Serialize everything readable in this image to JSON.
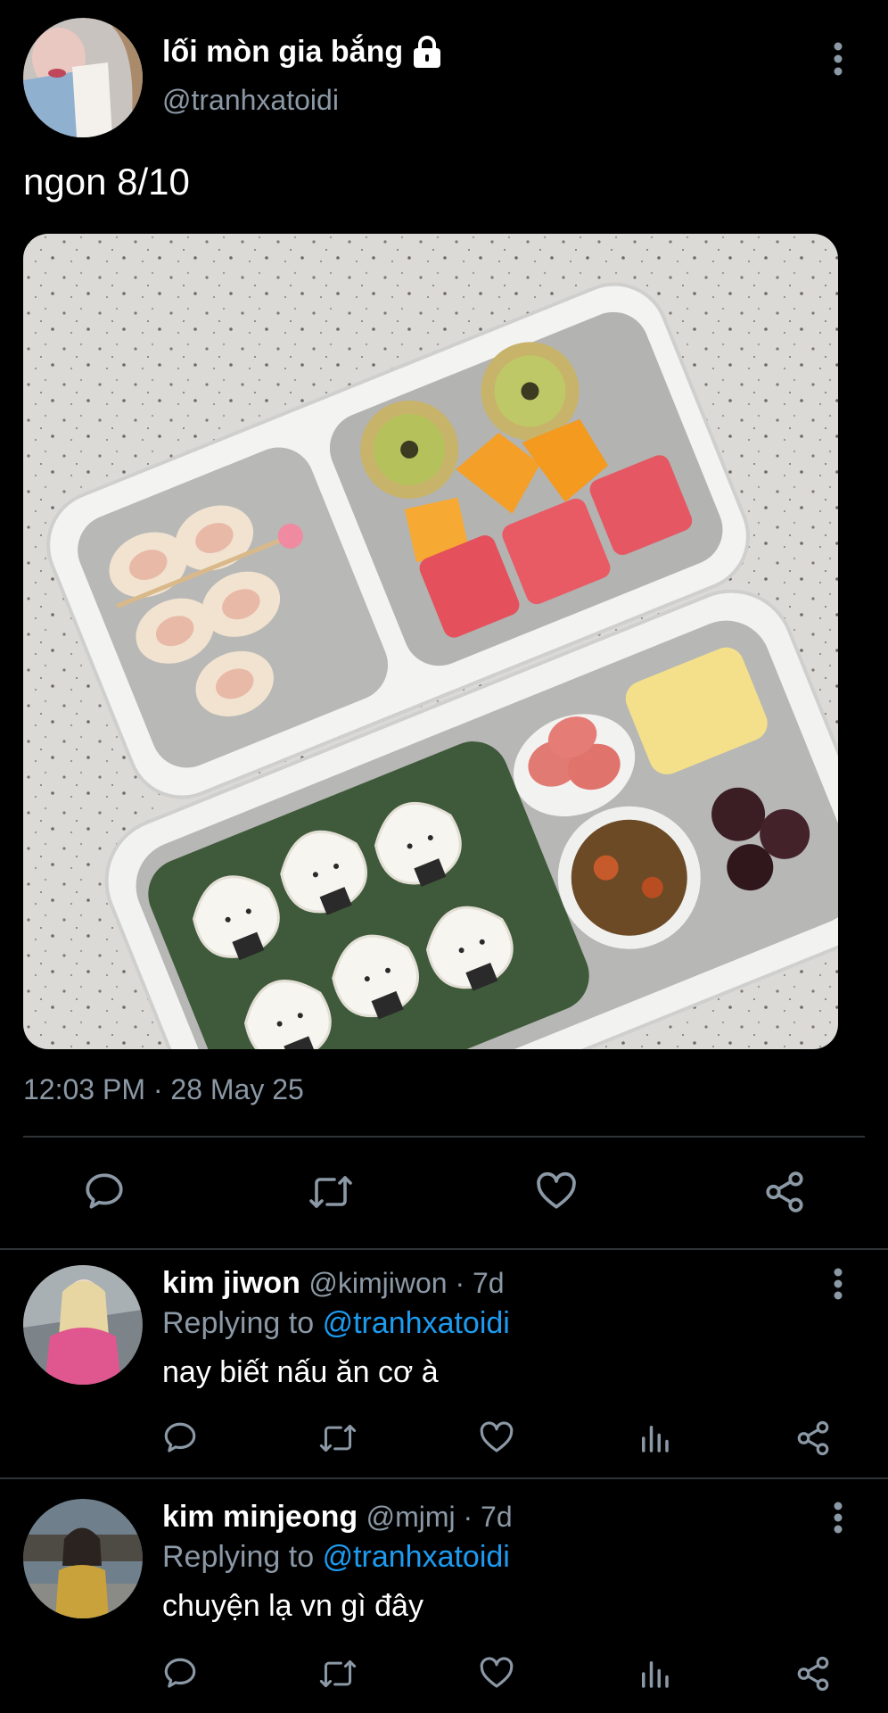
{
  "tweet": {
    "author_name": "lối mòn gia bắng",
    "author_handle": "@tranhxatoidi",
    "text": "ngon 8/10",
    "timestamp": "12:03 PM · 28 May 25",
    "image_alt": "bento box with onigiri, fruit, sausages, egg roll and kimchi"
  },
  "replies": [
    {
      "name": "kim jiwon",
      "meta": "@kimjiwon · 7d",
      "replying_prefix": "Replying to",
      "replying_handle": "@tranhxatoidi",
      "text": "nay biết nấu ăn cơ à"
    },
    {
      "name": "kim minjeong",
      "meta": "@mjmj · 7d",
      "replying_prefix": "Replying to",
      "replying_handle": "@tranhxatoidi",
      "text": "chuyện lạ vn gì đây"
    }
  ],
  "icons": {
    "reply": "reply-icon",
    "retweet": "retweet-icon",
    "like": "heart-icon",
    "share": "share-icon",
    "stats": "stats-icon",
    "more": "more-options-icon",
    "lock": "lock-icon"
  },
  "colors": {
    "background": "#000000",
    "text": "#e7e9ea",
    "muted": "#8b98a5",
    "link": "#1d9bf0",
    "divider": "#2f3336"
  }
}
